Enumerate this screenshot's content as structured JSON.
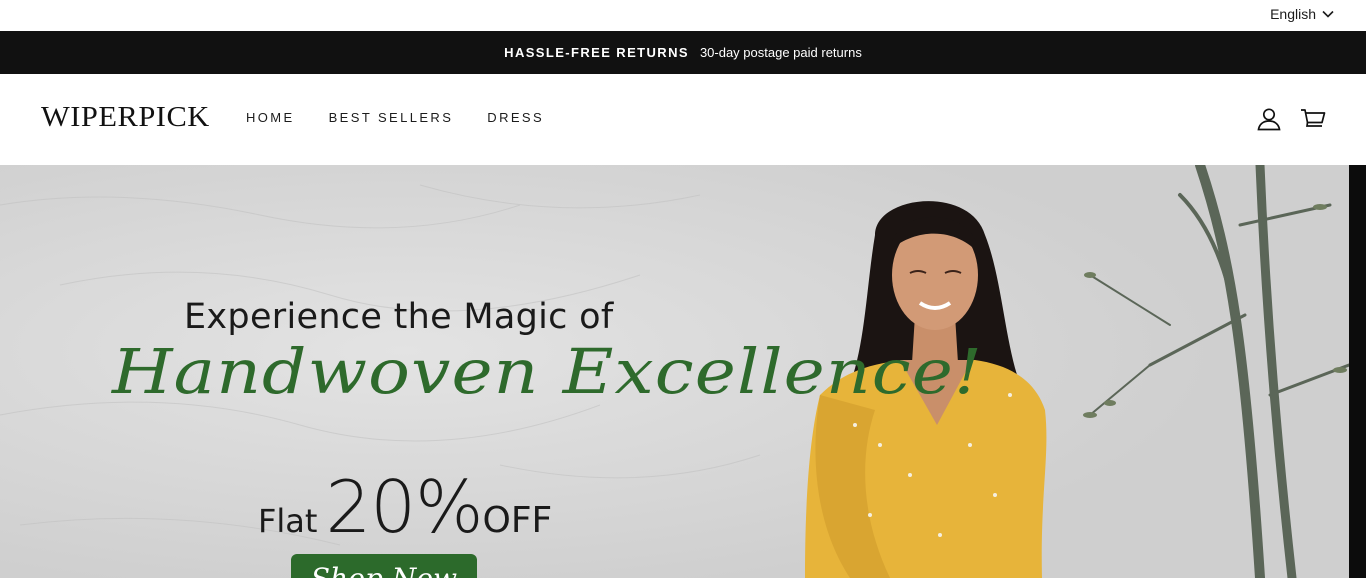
{
  "language": {
    "selected": "English",
    "icon": "chevron-down-icon"
  },
  "announcement": {
    "strong": "HASSLE-FREE RETURNS",
    "text": "30-day postage paid returns"
  },
  "header": {
    "logo": "WIPERPICK",
    "nav": [
      {
        "label": "HOME"
      },
      {
        "label": "BEST SELLERS"
      },
      {
        "label": "DRESS"
      }
    ],
    "icons": [
      "account-icon",
      "cart-icon"
    ]
  },
  "hero": {
    "line1": "Experience the Magic of",
    "line2": "Handwoven Excellence!",
    "flat": "Flat",
    "percent": "20%",
    "off": "OFF",
    "cta": "Shop Now"
  },
  "colors": {
    "accent_green": "#2c6a2b",
    "announcement_bg": "#111111",
    "dress_yellow": "#e7b43a"
  }
}
